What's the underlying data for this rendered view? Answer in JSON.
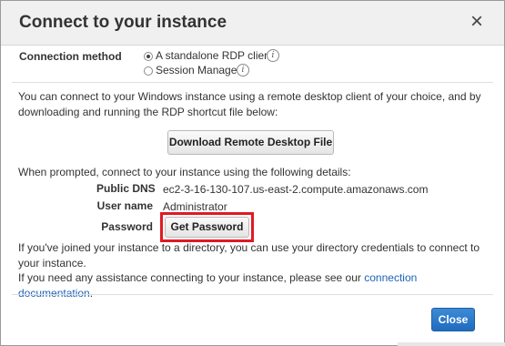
{
  "dialog": {
    "title": "Connect to your instance",
    "close_symbol": "×",
    "close_icon": "close-icon"
  },
  "connection_method": {
    "label": "Connection method",
    "options": [
      {
        "label": "A standalone RDP client",
        "selected": true,
        "info_icon": "info-icon"
      },
      {
        "label": "Session Manager",
        "selected": false,
        "info_icon": "info-icon"
      }
    ],
    "info_symbol": "i"
  },
  "instructions": {
    "intro": "You can connect to your Windows instance using a remote desktop client of your choice, and by downloading and running the RDP shortcut file below:",
    "download_button": "Download Remote Desktop File",
    "prompt": "When prompted, connect to your instance using the following details:"
  },
  "details": {
    "public_dns_label": "Public DNS",
    "public_dns_value": "ec2-3-16-130-107.us-east-2.compute.amazonaws.com",
    "user_name_label": "User name",
    "user_name_value": "Administrator",
    "password_label": "Password",
    "get_password_button": "Get Password"
  },
  "footer_text": {
    "directory_note": "If you've joined your instance to a directory, you can use your directory credentials to connect to your instance.",
    "assistance_prefix": "If you need any assistance connecting to your instance, please see our ",
    "assistance_link": "connection documentation",
    "assistance_suffix": "."
  },
  "actions": {
    "close_button": "Close"
  },
  "colors": {
    "highlight_border": "#e01a24",
    "primary_button": "#1f6cc0",
    "link": "#1e63b8",
    "header_background": "#f0f0f0"
  }
}
